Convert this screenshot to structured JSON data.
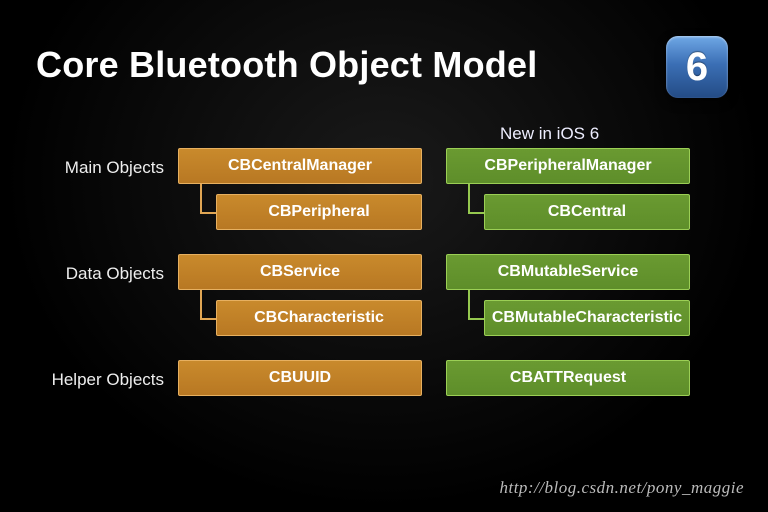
{
  "title": "Core Bluetooth Object Model",
  "badge": "6",
  "column_header_right": "New in iOS 6",
  "rows": [
    {
      "label": "Main Objects",
      "left": {
        "parent": "CBCentralManager",
        "child": "CBPeripheral"
      },
      "right": {
        "parent": "CBPeripheralManager",
        "child": "CBCentral"
      }
    },
    {
      "label": "Data Objects",
      "left": {
        "parent": "CBService",
        "child": "CBCharacteristic"
      },
      "right": {
        "parent": "CBMutableService",
        "child": "CBMutableCharacteristic"
      }
    },
    {
      "label": "Helper Objects",
      "left": {
        "parent": "CBUUID"
      },
      "right": {
        "parent": "CBATTRequest"
      }
    }
  ],
  "watermark": "http://blog.csdn.net/pony_maggie",
  "colors": {
    "orange": "#b87823",
    "green": "#5e8e2a"
  }
}
